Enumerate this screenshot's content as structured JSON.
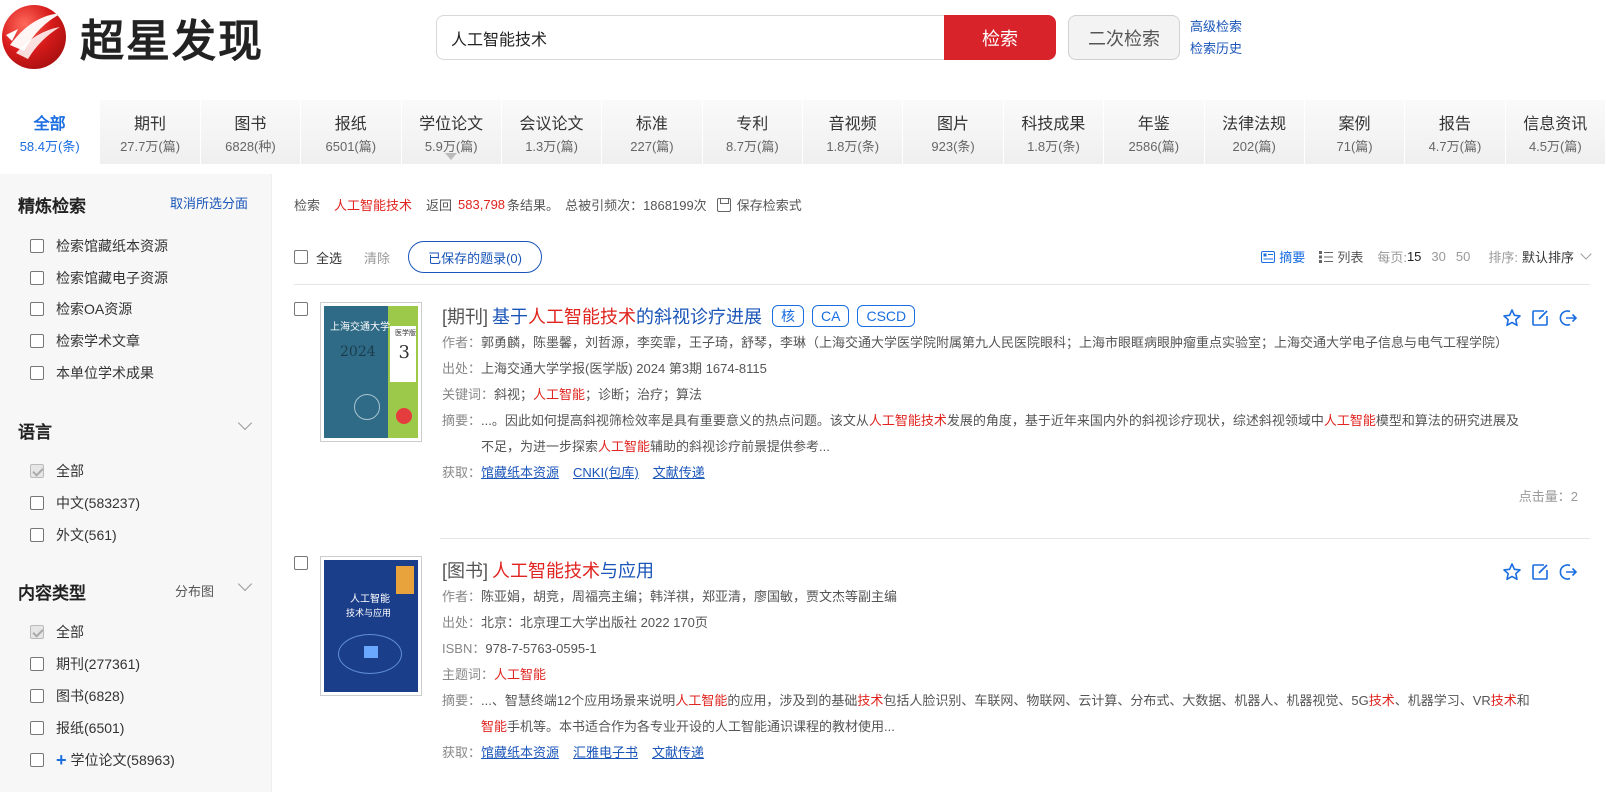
{
  "header": {
    "logo_text": "超星发现",
    "search_value": "人工智能技术",
    "search_button": "检索",
    "second_search_button": "二次检索",
    "advanced_search": "高级检索",
    "search_history": "检索历史"
  },
  "tabs": [
    {
      "name": "全部",
      "count": "58.4万(条)",
      "active": true
    },
    {
      "name": "期刊",
      "count": "27.7万(篇)"
    },
    {
      "name": "图书",
      "count": "6828(种)"
    },
    {
      "name": "报纸",
      "count": "6501(篇)"
    },
    {
      "name": "学位论文",
      "count": "5.9万(篇)"
    },
    {
      "name": "会议论文",
      "count": "1.3万(篇)"
    },
    {
      "name": "标准",
      "count": "227(篇)"
    },
    {
      "name": "专利",
      "count": "8.7万(篇)"
    },
    {
      "name": "音视频",
      "count": "1.8万(条)"
    },
    {
      "name": "图片",
      "count": "923(条)"
    },
    {
      "name": "科技成果",
      "count": "1.8万(条)"
    },
    {
      "name": "年鉴",
      "count": "2586(篇)"
    },
    {
      "name": "法律法规",
      "count": "202(篇)"
    },
    {
      "name": "案例",
      "count": "71(篇)"
    },
    {
      "name": "报告",
      "count": "4.7万(篇)"
    },
    {
      "name": "信息资讯",
      "count": "4.5万(篇)"
    }
  ],
  "sidebar": {
    "refine_title": "精炼检索",
    "clear_all": "取消所选分面",
    "refine_items": [
      "检索馆藏纸本资源",
      "检索馆藏电子资源",
      "检索OA资源",
      "检索学术文章",
      "本单位学术成果"
    ],
    "language_title": "语言",
    "language_items": [
      "全部",
      "中文(583237)",
      "外文(561)"
    ],
    "content_title": "内容类型",
    "distribution": "分布图",
    "content_items": [
      "全部",
      "期刊(277361)",
      "图书(6828)",
      "报纸(6501)",
      "学位论文(58963)"
    ]
  },
  "summary": {
    "search_label": "检索",
    "keyword": "人工智能技术",
    "return_label": "返回",
    "count": "583,798",
    "results_label": "条结果。",
    "citations": "总被引频次：1868199次",
    "save_expr": "保存检索式"
  },
  "toolbar": {
    "select_all": "全选",
    "clear": "清除",
    "saved": "已保存的题录(0)",
    "view_summary": "摘要",
    "view_list": "列表",
    "per_page_label": "每页:",
    "per_page_options": [
      "15",
      "30",
      "50"
    ],
    "sort_label": "排序:",
    "sort_value": "默认排序"
  },
  "results": [
    {
      "type": "[期刊]",
      "title_pre": "基于",
      "title_hl": "人工智能技术",
      "title_post": "的斜视诊疗进展",
      "badges": [
        "核",
        "CA",
        "CSCD"
      ],
      "author_label": "作者：",
      "authors": "郭勇麟，陈墨馨，刘哲源，李奕霏，王子琦，舒琴，李琳（上海交通大学医学院附属第九人民医院眼科；上海市眼眶病眼肿瘤重点实验室；上海交通大学电子信息与电气工程学院）",
      "source_label": "出处：",
      "source": "上海交通大学学报(医学版) 2024 第3期  1674-8115",
      "kw_label": "关键词：",
      "kw_pre": "斜视；",
      "kw_hl": "人工智能",
      "kw_post": "；诊断；治疗；算法",
      "abs_label": "摘要：",
      "abs_1": "...。因此如何提高斜视筛检效率是具有重要意义的热点问题。该文从",
      "abs_hl1": "人工智能技术",
      "abs_2": "发展的角度，基于近年来国内外的斜视诊疗现状，综述斜视领域中",
      "abs_hl2": "人工智能",
      "abs_3": "模型和算法的研究进展及不足，为进一步探索",
      "abs_hl3": "人工智能",
      "abs_4": "辅助的斜视诊疗前景提供参考...",
      "get_label": "获取：",
      "links": [
        "馆藏纸本资源",
        "CNKI(包库)",
        "文献传递"
      ],
      "clicks": "点击量：2",
      "cover_title": "上海交通大学",
      "cover_year": "2024",
      "cover_issue": "3",
      "cover_sub": "医学版"
    },
    {
      "type": "[图书]",
      "title_hl": "人工智能技术",
      "title_post": "与应用",
      "author_label": "作者：",
      "authors": "陈亚娟，胡竞，周福亮主编；韩洋祺，郑亚清，廖国敏，贾文杰等副主编",
      "source_label": "出处：",
      "source": "北京：北京理工大学出版社 2022 170页",
      "isbn_label": "ISBN：",
      "isbn": "978-7-5763-0595-1",
      "subject_label": "主题词：",
      "subject": "人工智能",
      "abs_label": "摘要：",
      "abs_1": "...、智慧终端12个应用场景来说明",
      "abs_hl1": "人工智能",
      "abs_2": "的应用，涉及到的基础",
      "abs_hl2": "技术",
      "abs_3": "包括人脸识别、车联网、物联网、云计算、分布式、大数据、机器人、机器视觉、5G",
      "abs_hl3": "技术",
      "abs_4": "、机器学习、VR",
      "abs_hl4": "技术",
      "abs_5": "和",
      "abs_hl5": "智能",
      "abs_6": "手机等。本书适合作为各专业开设的人工智能通识课程的教材使用...",
      "get_label": "获取：",
      "links": [
        "馆藏纸本资源",
        "汇雅电子书",
        "文献传递"
      ],
      "cover_title": "人工智能",
      "cover_sub": "技术与应用"
    }
  ]
}
